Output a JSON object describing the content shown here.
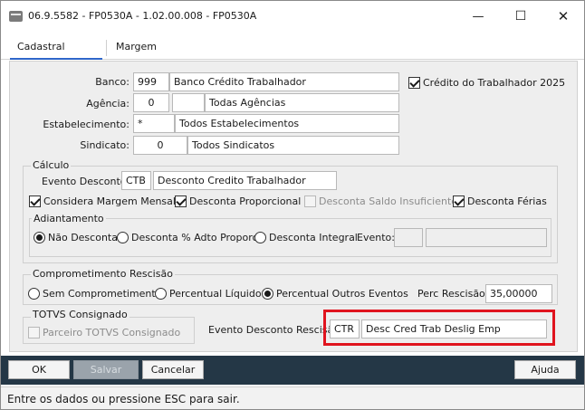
{
  "window": {
    "title": "06.9.5582 - FP0530A - 1.02.00.008 - FP0530A",
    "minimize": "—",
    "maximize": "☐",
    "close": "✕"
  },
  "tabs": [
    {
      "label": "Cadastral",
      "active": true
    },
    {
      "label": "Margem",
      "active": false
    }
  ],
  "header": {
    "banco_label": "Banco:",
    "banco_code": "999",
    "banco_desc": "Banco Crédito Trabalhador",
    "credito_trabalhador_label": "Crédito do Trabalhador 2025",
    "agencia_label": "Agência:",
    "agencia_code": "0",
    "agencia_desc": "Todas Agências",
    "estabelecimento_label": "Estabelecimento:",
    "estabelecimento_code": "*",
    "estabelecimento_desc": "Todos Estabelecimentos",
    "sindicato_label": "Sindicato:",
    "sindicato_code": "0",
    "sindicato_desc": "Todos Sindicatos"
  },
  "calculo": {
    "title": "Cálculo",
    "evento_label": "Evento Desconto:",
    "evento_code": "CTB",
    "evento_desc": "Desconto Credito Trabalhador",
    "considera_margem": "Considera Margem Mensal",
    "desconta_proporcional": "Desconta Proporcional",
    "desconta_saldo": "Desconta Saldo Insuficiente",
    "desconta_ferias": "Desconta Férias",
    "adiantamento": {
      "title": "Adiantamento",
      "nao_desconta": "Não Desconta",
      "desconta_pct": "Desconta % Adto Proporc",
      "desconta_integral": "Desconta Integral",
      "evento_label": "Evento:"
    }
  },
  "rescisao": {
    "title": "Comprometimento Rescisão",
    "sem": "Sem Comprometimento",
    "percentual_liquido": "Percentual Líquido",
    "percentual_outros": "Percentual Outros Eventos",
    "perc_label": "Perc Rescisão:",
    "perc_value": "35,00000"
  },
  "totvs": {
    "title": "TOTVS Consignado",
    "parceiro": "Parceiro TOTVS Consignado"
  },
  "evento_rescisao": {
    "label": "Evento Desconto Rescisão:",
    "code": "CTR",
    "desc": "Desc Cred Trab Deslig Emp"
  },
  "buttons": {
    "ok": "OK",
    "salvar": "Salvar",
    "cancelar": "Cancelar",
    "ajuda": "Ajuda"
  },
  "status": "Entre os dados ou pressione ESC para sair.",
  "colors": {
    "button_bar": "#243746",
    "highlight": "#e0141e",
    "tab_accent": "#2e66c9"
  }
}
